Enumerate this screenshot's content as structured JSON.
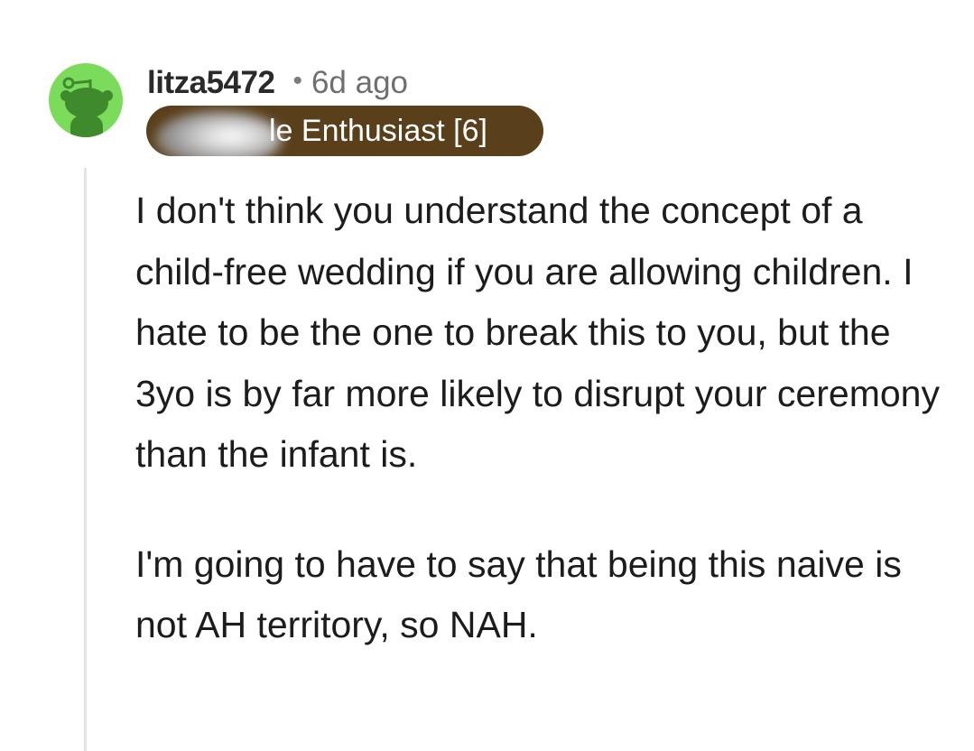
{
  "comment": {
    "username": "litza5472",
    "separator": "•",
    "time": "6d ago",
    "flair": "le Enthusiast [6]",
    "paragraphs": [
      "I don't think you understand the concept of a child-free wedding if you are allowing children. I hate to be the one to break this to you, but the 3yo is by far more likely to disrupt your ceremony than the infant is.",
      "I'm going to have to say that being this naive is not AH territory, so NAH."
    ]
  },
  "colors": {
    "avatar_bg": "#7bdc5c",
    "flair_bg": "#5a3f1b",
    "text": "#1c1c1c",
    "thread_line": "#e4e4e4"
  },
  "icons": {
    "avatar": "reddit-snoo-avatar-icon"
  }
}
